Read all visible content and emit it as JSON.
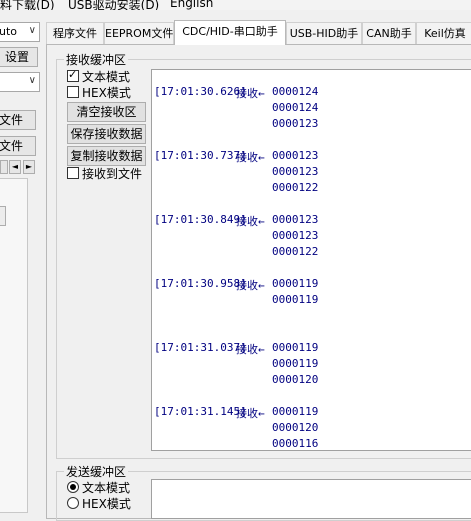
{
  "menubar": {
    "items": [
      "料下载(D)",
      "USB驱动安装(D)",
      "English"
    ]
  },
  "left_panel": {
    "combo_auto": "uto",
    "settings_button": "设置",
    "file_button_1": "文件",
    "file_button_2": "文件",
    "scroll_left": "◄",
    "scroll_right": "►"
  },
  "tabs": [
    {
      "label": "程序文件"
    },
    {
      "label": "EEPROM文件"
    },
    {
      "label": "CDC/HID-串口助手"
    },
    {
      "label": "USB-HID助手"
    },
    {
      "label": "CAN助手"
    },
    {
      "label": "Keil仿真"
    }
  ],
  "receive": {
    "title": "接收缓冲区",
    "text_mode_label": "文本模式",
    "hex_mode_label": "HEX模式",
    "text_mode_checked": true,
    "hex_mode_checked": false,
    "clear_button": "清空接收区",
    "save_button": "保存接收数据",
    "copy_button": "复制接收数据",
    "to_file_label": "接收到文件",
    "to_file_checked": false,
    "log": [
      {
        "timestamp": "[17:01:30.626]",
        "prefix": "接收←",
        "values": [
          "0000124",
          "0000124",
          "0000123"
        ]
      },
      {
        "timestamp": "[17:01:30.737]",
        "prefix": "接收←",
        "values": [
          "0000123",
          "0000123",
          "0000122"
        ]
      },
      {
        "timestamp": "[17:01:30.849]",
        "prefix": "接收←",
        "values": [
          "0000123",
          "0000123",
          "0000122"
        ]
      },
      {
        "timestamp": "[17:01:30.958]",
        "prefix": "接收←",
        "values": [
          "0000119",
          "0000119"
        ]
      },
      {
        "timestamp": "[17:01:31.037]",
        "prefix": "接收←",
        "values": [
          "0000119",
          "0000119",
          "0000120"
        ]
      },
      {
        "timestamp": "[17:01:31.145]",
        "prefix": "接收←",
        "values": [
          "0000119",
          "0000120",
          "0000116"
        ]
      }
    ]
  },
  "send": {
    "title": "发送缓冲区",
    "text_mode_label": "文本模式",
    "hex_mode_label": "HEX模式",
    "selected_mode": "text"
  }
}
